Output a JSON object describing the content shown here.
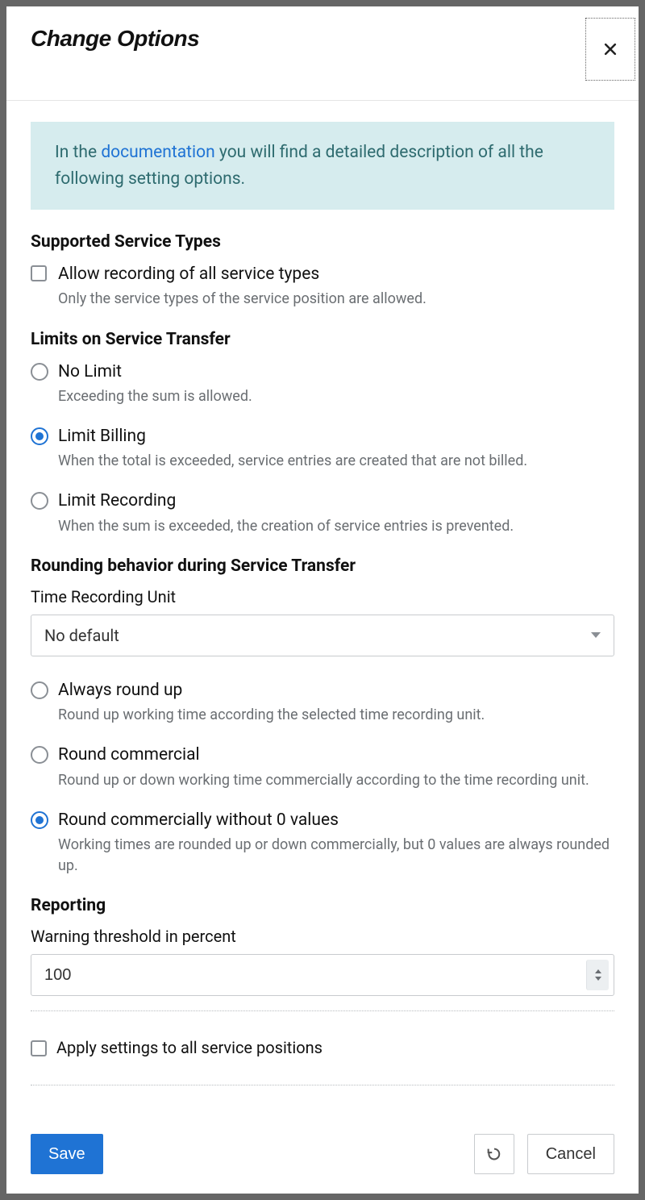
{
  "modal": {
    "title": "Change Options"
  },
  "info": {
    "prefix": "In the ",
    "link": "documentation",
    "suffix": " you will find a detailed description of all the following setting options."
  },
  "sections": {
    "supported": {
      "title": "Supported Service Types",
      "allow_all": {
        "label": "Allow recording of all service types",
        "desc": "Only the service types of the service position are allowed.",
        "checked": false
      }
    },
    "limits": {
      "title": "Limits on Service Transfer",
      "options": [
        {
          "label": "No Limit",
          "desc": "Exceeding the sum is allowed.",
          "selected": false
        },
        {
          "label": "Limit Billing",
          "desc": "When the total is exceeded, service entries are created that are not billed.",
          "selected": true
        },
        {
          "label": "Limit Recording",
          "desc": "When the sum is exceeded, the creation of service entries is prevented.",
          "selected": false
        }
      ]
    },
    "rounding": {
      "title": "Rounding behavior during Service Transfer",
      "unit_label": "Time Recording Unit",
      "unit_value": "No default",
      "options": [
        {
          "label": "Always round up",
          "desc": "Round up working time according the selected time recording unit.",
          "selected": false
        },
        {
          "label": "Round commercial",
          "desc": "Round up or down working time commercially according to the time recording unit.",
          "selected": false
        },
        {
          "label": "Round commercially without 0 values",
          "desc": "Working times are rounded up or down commercially, but 0 values are always rounded up.",
          "selected": true
        }
      ]
    },
    "reporting": {
      "title": "Reporting",
      "threshold_label": "Warning threshold in percent",
      "threshold_value": "100"
    },
    "apply_all": {
      "label": "Apply settings to all service positions",
      "checked": false
    }
  },
  "footer": {
    "save": "Save",
    "cancel": "Cancel"
  }
}
